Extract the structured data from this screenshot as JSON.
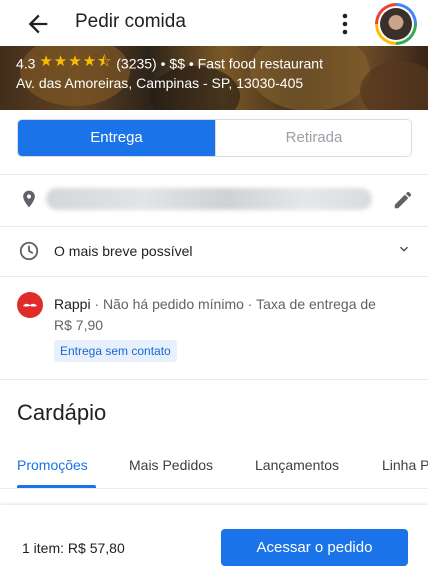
{
  "header": {
    "title": "Pedir comida"
  },
  "restaurant": {
    "rating": "4.3",
    "stars": "★★★★⯪",
    "reviews": "(3235)",
    "price": "$$",
    "category": "Fast food restaurant",
    "separator": "•",
    "address": "Av. das Amoreiras, Campinas - SP, 13030-405"
  },
  "delivery_toggle": {
    "options": [
      "Entrega",
      "Retirada"
    ],
    "selected": "Entrega"
  },
  "time": {
    "label": "O mais breve possível"
  },
  "provider": {
    "name": "Rappi",
    "min_order": " · Não há pedido mínimo · Taxa de entrega de",
    "fee": "R$ 7,90",
    "badge": "Entrega sem contato"
  },
  "menu": {
    "title": "Cardápio",
    "tabs": [
      "Promoções",
      "Mais Pedidos",
      "Lançamentos",
      "Linha P"
    ]
  },
  "cart": {
    "summary": "1 item: R$ 57,80",
    "cta": "Acessar o pedido"
  },
  "colors": {
    "accent": "#1a73e8",
    "star": "#fbbc04",
    "provider_logo": "#e02b2b"
  },
  "icons": [
    "back-arrow-icon",
    "more-vert-icon",
    "location-pin-icon",
    "edit-pencil-icon",
    "clock-icon",
    "chevron-down-icon",
    "rappi-logo-icon"
  ]
}
